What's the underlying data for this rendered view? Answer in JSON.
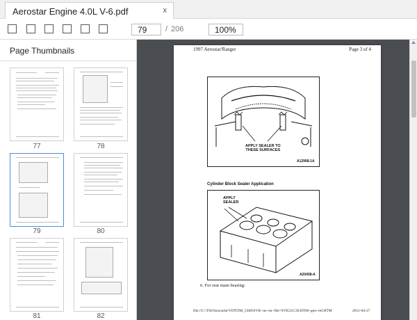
{
  "tab": {
    "title": "Aerostar Engine 4.0L V-6.pdf",
    "close_glyph": "x"
  },
  "toolbar": {
    "buttons": [
      "sidebar-toggle-button",
      "tool-button-2",
      "tool-button-3",
      "tool-button-4",
      "tool-button-5",
      "tool-button-6"
    ],
    "page_current": "79",
    "page_separator": "/",
    "page_total": "206",
    "zoom": "100%"
  },
  "sidebar": {
    "title": "Page Thumbnails",
    "thumbnails": [
      {
        "number": "77",
        "selected": false
      },
      {
        "number": "78",
        "selected": false
      },
      {
        "number": "79",
        "selected": true
      },
      {
        "number": "80",
        "selected": false
      },
      {
        "number": "81",
        "selected": false
      },
      {
        "number": "82",
        "selected": false
      }
    ]
  },
  "document": {
    "header_left": "1997 Aerostar/Ranger",
    "header_right": "Page 3 of 4",
    "figure1": {
      "label": "APPLY SEALER TO\nTHESE SURFACES",
      "code": "A12968-1A"
    },
    "caption": "Cylinder Block Sealer Application",
    "figure2": {
      "label": "APPLY\nSEALER",
      "code": "A20458-A"
    },
    "step": "6.   For rear main bearing:",
    "footer_path": "file://C:\\TSO\\tsocache\\VDTOM_5368\\SVK~us~en~file=SVK31C30.HTM~gen~ref.HTM",
    "footer_date": "2011-04-27"
  },
  "colors": {
    "viewer_bg": "#4a4d52",
    "selected_thumb": "#4a90d9"
  }
}
